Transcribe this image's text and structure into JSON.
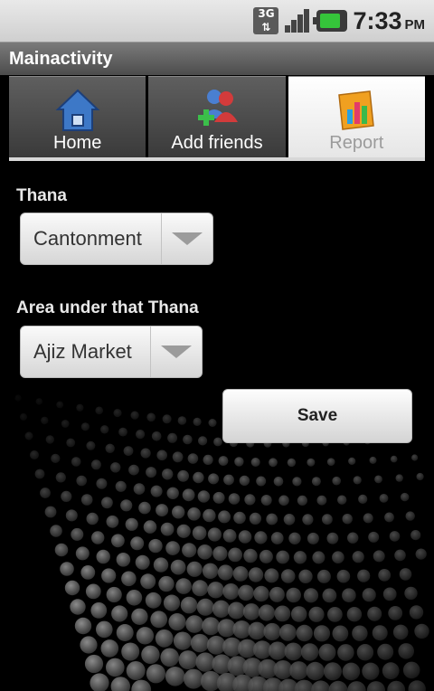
{
  "status_bar": {
    "network_label_top": "3G",
    "network_label_bottom": "⇅",
    "time": "7:33",
    "ampm": "PM",
    "icons": [
      "3g-icon",
      "signal-icon",
      "battery-charging-icon"
    ]
  },
  "title_bar": {
    "title": "Mainactivity"
  },
  "tabs": [
    {
      "label": "Home",
      "icon": "home-icon",
      "active": false
    },
    {
      "label": "Add friends",
      "icon": "add-friends-icon",
      "active": false
    },
    {
      "label": "Report",
      "icon": "report-icon",
      "active": true
    }
  ],
  "form": {
    "thana_label": "Thana",
    "thana_value": "Cantonment",
    "area_label": "Area under that Thana",
    "area_value": "Ajiz Market",
    "save_label": "Save"
  },
  "colors": {
    "active_tab_label": "#9b9b9b",
    "battery_green": "#35c43a"
  }
}
